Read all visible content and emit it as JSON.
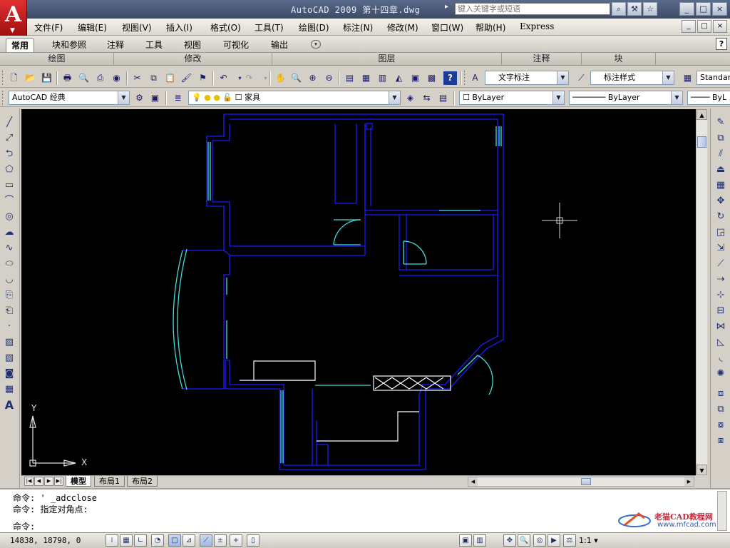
{
  "window": {
    "title": "AutoCAD 2009 第十四章.dwg",
    "search_placeholder": "键入关键字或短语",
    "controls": [
      "_",
      "□",
      "×"
    ],
    "doc_controls": [
      "_",
      "□",
      "×"
    ]
  },
  "menu": {
    "items": [
      "文件(F)",
      "编辑(E)",
      "视图(V)",
      "插入(I)",
      "格式(O)",
      "工具(T)",
      "绘图(D)",
      "标注(N)",
      "修改(M)",
      "窗口(W)",
      "帮助(H)",
      "Express"
    ]
  },
  "ribbon": {
    "tabs": [
      "常用",
      "块和参照",
      "注释",
      "工具",
      "视图",
      "可视化",
      "输出"
    ],
    "active_tab": "常用",
    "panels": [
      "绘图",
      "修改",
      "图层",
      "注释",
      "块"
    ]
  },
  "toolbar1": {
    "text_style": "文字标注",
    "dim_style": "标注样式",
    "table_style": "Standard"
  },
  "toolbar2": {
    "workspace": "AutoCAD 经典",
    "layer": "家具",
    "color": "ByLayer",
    "linetype": "ByLayer",
    "lineweight": "ByL"
  },
  "layout_tabs": [
    "模型",
    "布局1",
    "布局2"
  ],
  "active_layout": "模型",
  "ucs": {
    "x_label": "X",
    "y_label": "Y"
  },
  "command": {
    "lines": [
      "命令: ' _adcclose",
      "命令: 指定对角点:",
      "命令:"
    ]
  },
  "status": {
    "coords": "14838, 18798, 0",
    "scale": "1:1"
  },
  "watermark": {
    "title": "老猫CAD教程网",
    "url": "www.mfcad.com"
  },
  "colors": {
    "canvas": "#000000",
    "walls": "#1a1aff",
    "windows": "#40e0e0",
    "furniture": "#ffffff",
    "title_bar": "#4a5a7a",
    "logo": "#d02020"
  }
}
